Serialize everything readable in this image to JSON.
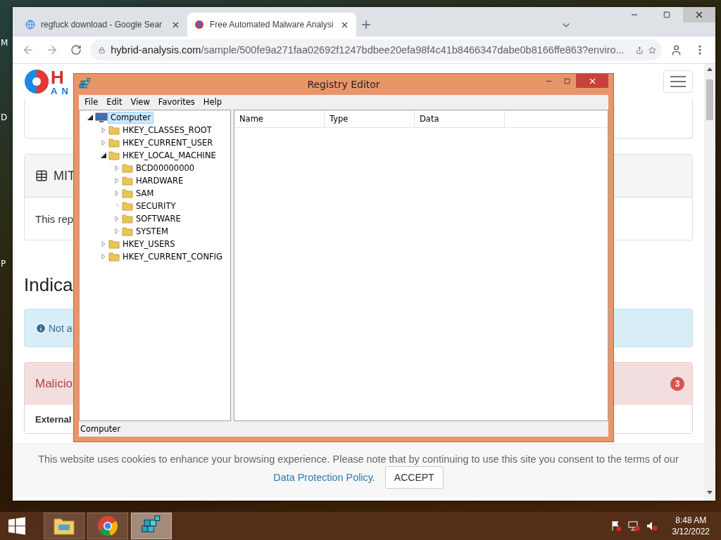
{
  "desktop": {
    "edge_labels": [
      "M",
      "D",
      "P"
    ]
  },
  "browser": {
    "tabs": [
      {
        "title": "regfuck download - Google Sear",
        "selected": false
      },
      {
        "title": "Free Automated Malware Analysi",
        "selected": true
      }
    ],
    "address": {
      "host": "hybrid-analysis.com",
      "path": "/sample/500fe9a271faa02692f1247bdbee20efa98f4c41b8466347dabe0b8166ffe863?enviro..."
    }
  },
  "page": {
    "logo": {
      "top": "H",
      "bottom": "AN"
    },
    "mitre_card": {
      "title": "MIT",
      "body": "This rep"
    },
    "heading": "Indica",
    "info_alert": "Not a",
    "malicious_panel": {
      "title": "Malicio",
      "badge": "3",
      "body": "External"
    },
    "cookie_notice": {
      "text": "This website uses cookies to enhance your browsing experience. Please note that by continuing to use this site you consent to the terms of our",
      "link": "Data Protection Policy.",
      "button": "ACCEPT"
    }
  },
  "regedit": {
    "title": "Registry Editor",
    "menu": [
      "File",
      "Edit",
      "View",
      "Favorites",
      "Help"
    ],
    "tree": [
      {
        "label": "Computer",
        "kind": "computer",
        "selected": true,
        "expandable": true,
        "expanded": true,
        "children": [
          {
            "label": "HKEY_CLASSES_ROOT",
            "kind": "folder",
            "selected": false,
            "expandable": true,
            "expanded": false
          },
          {
            "label": "HKEY_CURRENT_USER",
            "kind": "folder",
            "selected": false,
            "expandable": true,
            "expanded": false
          },
          {
            "label": "HKEY_LOCAL_MACHINE",
            "kind": "folder",
            "selected": false,
            "expandable": true,
            "expanded": true,
            "children": [
              {
                "label": "BCD00000000",
                "kind": "folder",
                "selected": false,
                "expandable": true,
                "expanded": false
              },
              {
                "label": "HARDWARE",
                "kind": "folder",
                "selected": false,
                "expandable": true,
                "expanded": false
              },
              {
                "label": "SAM",
                "kind": "folder",
                "selected": false,
                "expandable": true,
                "expanded": false
              },
              {
                "label": "SECURITY",
                "kind": "folder",
                "selected": false,
                "expandable": false
              },
              {
                "label": "SOFTWARE",
                "kind": "folder",
                "selected": false,
                "expandable": true,
                "expanded": false
              },
              {
                "label": "SYSTEM",
                "kind": "folder",
                "selected": false,
                "expandable": true,
                "expanded": false
              }
            ]
          },
          {
            "label": "HKEY_USERS",
            "kind": "folder",
            "selected": false,
            "expandable": true,
            "expanded": false
          },
          {
            "label": "HKEY_CURRENT_CONFIG",
            "kind": "folder",
            "selected": false,
            "expandable": true,
            "expanded": false
          }
        ]
      }
    ],
    "columns": [
      "Name",
      "Type",
      "Data"
    ],
    "status": "Computer"
  },
  "taskbar": {
    "apps": [
      {
        "kind": "explorer",
        "selected": false
      },
      {
        "kind": "chrome",
        "selected": false
      },
      {
        "kind": "regedit",
        "selected": true
      }
    ],
    "time": "8:48 AM",
    "date": "3/12/2022"
  }
}
